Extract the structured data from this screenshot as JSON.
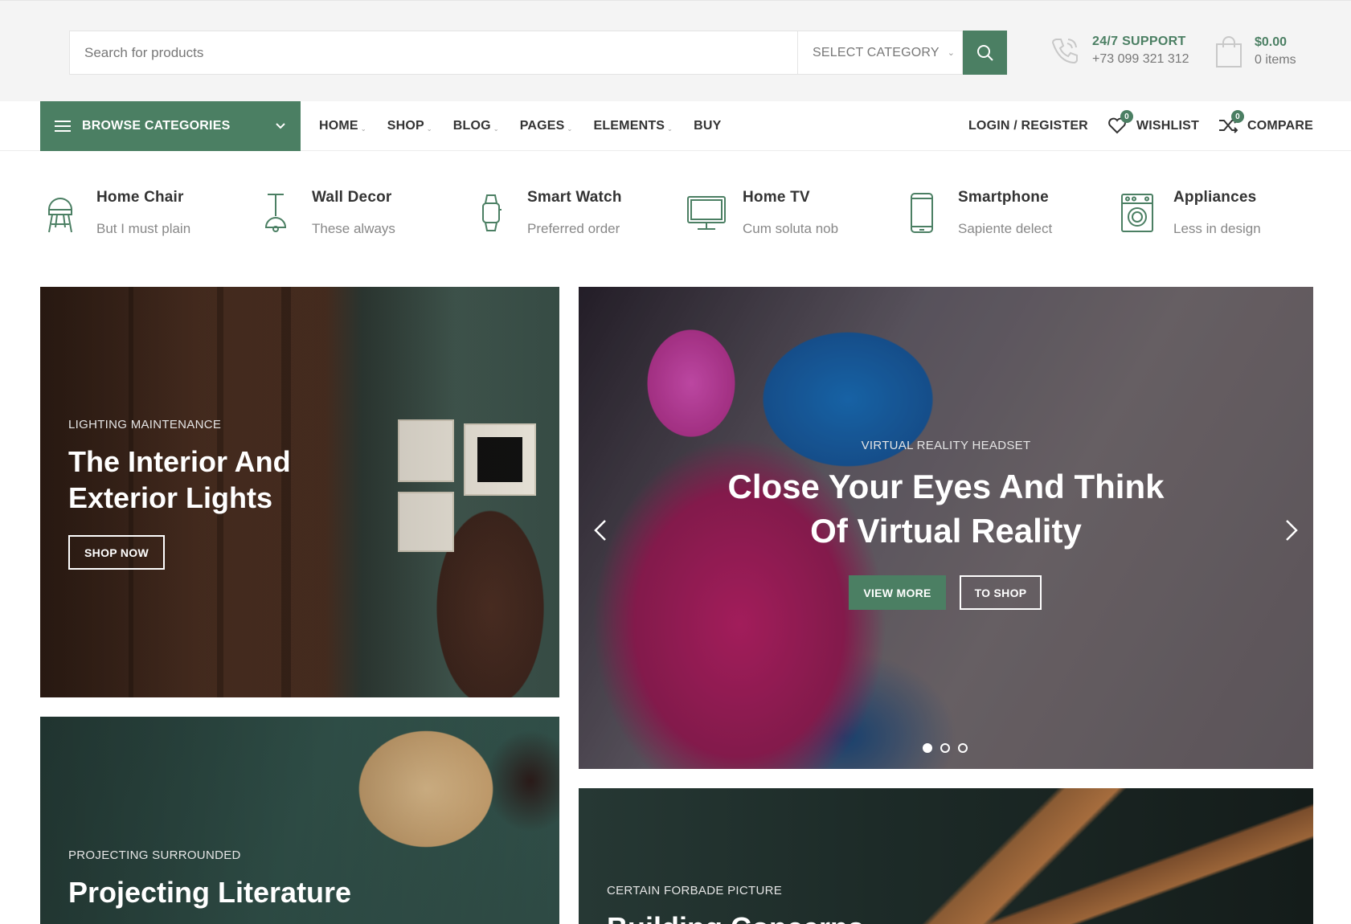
{
  "header": {
    "search_placeholder": "Search for products",
    "category_select": "SELECT CATEGORY",
    "support_title": "24/7 SUPPORT",
    "support_phone": "+73 099 321 312",
    "cart_total": "$0.00",
    "cart_items": "0 items"
  },
  "nav": {
    "browse_label": "BROWSE CATEGORIES",
    "menu": [
      "HOME",
      "SHOP",
      "BLOG",
      "PAGES",
      "ELEMENTS",
      "BUY"
    ],
    "login_label": "LOGIN / REGISTER",
    "wishlist_label": "WISHLIST",
    "wishlist_count": "0",
    "compare_label": "COMPARE",
    "compare_count": "0"
  },
  "categories": [
    {
      "title": "Home Chair",
      "subtitle": "But I must plain",
      "icon": "chair-icon"
    },
    {
      "title": "Wall Decor",
      "subtitle": "These always",
      "icon": "lamp-icon"
    },
    {
      "title": "Smart Watch",
      "subtitle": "Preferred order",
      "icon": "watch-icon"
    },
    {
      "title": "Home TV",
      "subtitle": "Cum soluta nob",
      "icon": "monitor-icon"
    },
    {
      "title": "Smartphone",
      "subtitle": "Sapiente delect",
      "icon": "smartphone-icon"
    },
    {
      "title": "Appliances",
      "subtitle": "Less in design",
      "icon": "washing-machine-icon"
    }
  ],
  "banners": {
    "lighting": {
      "eyebrow": "LIGHTING MAINTENANCE",
      "line1": "The Interior And",
      "line2": "Exterior Lights",
      "button": "SHOP NOW"
    },
    "vr": {
      "eyebrow": "VIRTUAL REALITY HEADSET",
      "line1": "Close Your Eyes And Think",
      "line2": "Of Virtual Reality",
      "button_primary": "VIEW MORE",
      "button_secondary": "TO SHOP",
      "slide_count": 3,
      "active_slide": 1
    },
    "projecting": {
      "eyebrow": "PROJECTING SURROUNDED",
      "line1": "Projecting Literature"
    },
    "building": {
      "eyebrow": "CERTAIN FORBADE PICTURE",
      "line1": "Building Concerns"
    }
  },
  "colors": {
    "accent": "#4b7f63"
  }
}
